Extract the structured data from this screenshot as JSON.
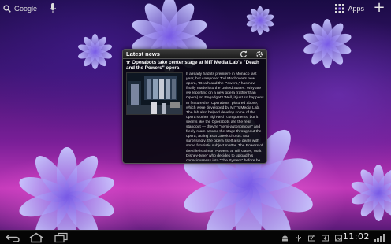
{
  "topbar": {
    "search_label": "Google",
    "apps_label": "Apps"
  },
  "icons": [
    "google-search-icon",
    "microphone-icon",
    "apps-grid-icon",
    "add-icon",
    "refresh-icon",
    "settings-icon",
    "back-icon",
    "home-icon",
    "recent-apps-icon",
    "android-debug-icon",
    "usb-icon",
    "notification-icon",
    "wifi-signal-icon"
  ],
  "colors": {
    "widget_bg": "#08080e",
    "accent": "#9a6bff"
  },
  "widget": {
    "title": "Latest news",
    "headline": "★ Operabots take center stage at MIT Media Lab's \"Death and the Powers\" opera",
    "body": "It already had its premiere in Monaco last year, but composer Tod Machover's new opera, \"Death and the Powers,\" has now finally made it to the United States. Why are we reporting on a new opera (rather than Opera) on Engadget? Well, it just so happens to feature the \"Operabots\" pictured above, which were developed by MIT's Media Lab. The lab also helped develop some of the opera's other high-tech components, but it seems like the Operabots are the real standout — they're \"semi-autonomous\" and freely roam around the stage throughout the opera, acting as a Greek chorus. Not surprisingly, the opera itself also deals with some futuristic subject matter. The Powers of the title is Simon Powers, a \"Bill Gates, Walt Disney-type\" who decides to upload his consciousness into \"The System\" before he dies — hijinks then ensue. Those in Boston can apparently still get tickets for the final performance on March 25th — after that it moves onto Chicago for four performances ..."
  },
  "sysbar": {
    "time": "11:02"
  }
}
